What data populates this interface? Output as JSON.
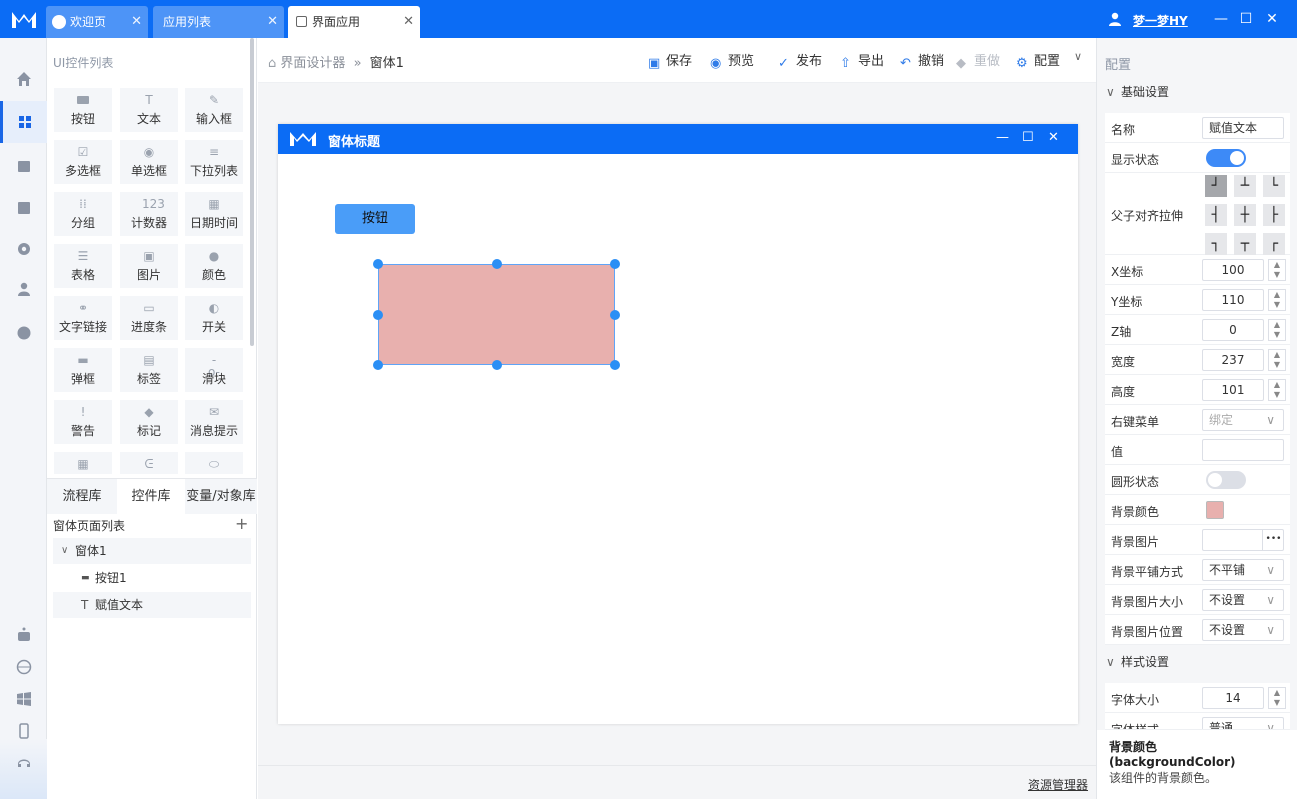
{
  "titlebar": {
    "tabs": [
      {
        "label": "欢迎页"
      },
      {
        "label": "应用列表"
      },
      {
        "label": "界面应用"
      }
    ],
    "username": "梦一梦HY"
  },
  "widget_panel": {
    "title": "UI控件列表",
    "widgets": [
      {
        "label": "按钮",
        "icon": "button-icon"
      },
      {
        "label": "文本",
        "icon": "text-T-icon",
        "glyph": "T"
      },
      {
        "label": "输入框",
        "icon": "pen-icon",
        "glyph": "✎"
      },
      {
        "label": "多选框",
        "icon": "checkbox-icon",
        "glyph": "☑"
      },
      {
        "label": "单选框",
        "icon": "radio-icon",
        "glyph": "◉"
      },
      {
        "label": "下拉列表",
        "icon": "dropdown-list-icon",
        "glyph": "≡"
      },
      {
        "label": "分组",
        "icon": "group-dots-icon",
        "glyph": "⁞⁞"
      },
      {
        "label": "计数器",
        "icon": "counter-123-icon",
        "glyph": "123"
      },
      {
        "label": "日期时间",
        "icon": "calendar-icon",
        "glyph": "▦"
      },
      {
        "label": "表格",
        "icon": "table-list-icon",
        "glyph": "☰"
      },
      {
        "label": "图片",
        "icon": "image-icon",
        "glyph": "▣"
      },
      {
        "label": "颜色",
        "icon": "palette-icon",
        "glyph": "●"
      },
      {
        "label": "文字链接",
        "icon": "link-icon",
        "glyph": "⚭"
      },
      {
        "label": "进度条",
        "icon": "progress-icon",
        "glyph": "▭"
      },
      {
        "label": "开关",
        "icon": "switch-icon",
        "glyph": "◐"
      },
      {
        "label": "弹框",
        "icon": "dialog-icon",
        "glyph": "▬"
      },
      {
        "label": "标签",
        "icon": "label-icon",
        "glyph": "▤"
      },
      {
        "label": "滑块",
        "icon": "slider-icon",
        "glyph": "-o-"
      },
      {
        "label": "警告",
        "icon": "warning-icon",
        "glyph": "!"
      },
      {
        "label": "标记",
        "icon": "tag-icon",
        "glyph": "◆"
      },
      {
        "label": "消息提示",
        "icon": "mail-icon",
        "glyph": "✉"
      },
      {
        "label": "",
        "icon": "grid-icon",
        "glyph": "▦"
      },
      {
        "label": "",
        "icon": "tree-icon",
        "glyph": "ᕮ"
      },
      {
        "label": "",
        "icon": "mouse-icon",
        "glyph": "⬭"
      }
    ],
    "lib_tabs": [
      "流程库",
      "控件库",
      "变量/对象库"
    ],
    "active_lib_tab": 1,
    "pagelist": {
      "title": "窗体页面列表",
      "add": "+",
      "items": [
        {
          "label": "窗体1",
          "level": 0,
          "glyph": "∨"
        },
        {
          "label": "按钮1",
          "level": 1,
          "glyph": "▬"
        },
        {
          "label": "赋值文本",
          "level": 1,
          "glyph": "T"
        }
      ]
    }
  },
  "breadcrumb": {
    "root": "界面设计器",
    "sep": "»",
    "current": "窗体1"
  },
  "toolbar": {
    "save": "保存",
    "preview": "预览",
    "publish": "发布",
    "export": "导出",
    "undo": "撤销",
    "redo": "重做",
    "config": "配置"
  },
  "form": {
    "title": "窗体标题",
    "button_label": "按钮",
    "rect_color": "#e8b0ae"
  },
  "statusbar": {
    "resource_link": "资源管理器"
  },
  "right_panel": {
    "title": "配置",
    "section_basic": "基础设置",
    "section_style": "样式设置",
    "props": {
      "name": {
        "label": "名称",
        "value": "赋值文本"
      },
      "visible": {
        "label": "显示状态",
        "on": true
      },
      "align": {
        "label": "父子对齐拉伸"
      },
      "x": {
        "label": "X坐标",
        "value": "100"
      },
      "y": {
        "label": "Y坐标",
        "value": "110"
      },
      "z": {
        "label": "Z轴",
        "value": "0"
      },
      "width": {
        "label": "宽度",
        "value": "237"
      },
      "height": {
        "label": "高度",
        "value": "101"
      },
      "context_menu": {
        "label": "右键菜单",
        "placeholder": "绑定"
      },
      "value": {
        "label": "值",
        "value": ""
      },
      "round": {
        "label": "圆形状态",
        "on": false
      },
      "bg_color": {
        "label": "背景颜色",
        "color": "#e8b0ae"
      },
      "bg_image": {
        "label": "背景图片",
        "button": "•••"
      },
      "bg_repeat": {
        "label": "背景平铺方式",
        "value": "不平铺"
      },
      "bg_size": {
        "label": "背景图片大小",
        "value": "不设置"
      },
      "bg_position": {
        "label": "背景图片位置",
        "value": "不设置"
      },
      "font_size": {
        "label": "字体大小",
        "value": "14"
      },
      "font_style": {
        "label": "字体样式",
        "value": "普通"
      }
    },
    "help": {
      "title": "背景颜色",
      "key": "(backgroundColor)",
      "desc": "该组件的背景颜色。"
    }
  },
  "colors": {
    "accent": "#0b6cf5",
    "primary_button": "#4a9df8",
    "toggle_on": "#3d8af7"
  }
}
